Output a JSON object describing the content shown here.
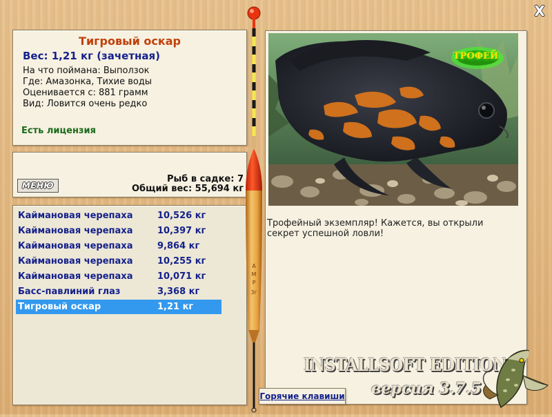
{
  "info": {
    "fish_name": "Тигровый оскар",
    "weight": "Вес: 1,21 кг (зачетная)",
    "bait": "На что поймана: Выползок",
    "location": "Где: Амазонка, Тихие воды",
    "price": "Оценивается с: 881 грамм",
    "rarity": "Вид: Ловится очень редко",
    "license": "Есть лицензия"
  },
  "stats": {
    "menu_label": "МЕНЮ",
    "count": "Рыб в садке: 7",
    "total_weight": "Общий вес: 55,694 кг"
  },
  "catch_list": [
    {
      "name": "Каймановая черепаха",
      "weight": "10,526 кг"
    },
    {
      "name": "Каймановая черепаха",
      "weight": "10,397 кг"
    },
    {
      "name": "Каймановая черепаха",
      "weight": "9,864 кг"
    },
    {
      "name": "Каймановая черепаха",
      "weight": "10,255 кг"
    },
    {
      "name": "Каймановая черепаха",
      "weight": "10,071 кг"
    },
    {
      "name": "Басс-павлиний глаз",
      "weight": "3,368 кг"
    },
    {
      "name": "Тигровый оскар",
      "weight": "1,21 кг",
      "selected": true
    }
  ],
  "detail": {
    "trophy_label": "ТРОФЕЙ",
    "description": "Трофейный экземпляр! Кажется, вы открыли секрет успешной ловли!"
  },
  "hotkeys_label": "Горячие клавиши",
  "close_label": "X",
  "branding": {
    "edition": "INSTALLSOFT EDITION",
    "version": "версия 3.7.5"
  },
  "colors": {
    "fish_name": "#c0400a",
    "link_blue": "#15218c",
    "license_green": "#1a6a1a",
    "selection": "#3399ee",
    "float_red": "#e8340f"
  }
}
